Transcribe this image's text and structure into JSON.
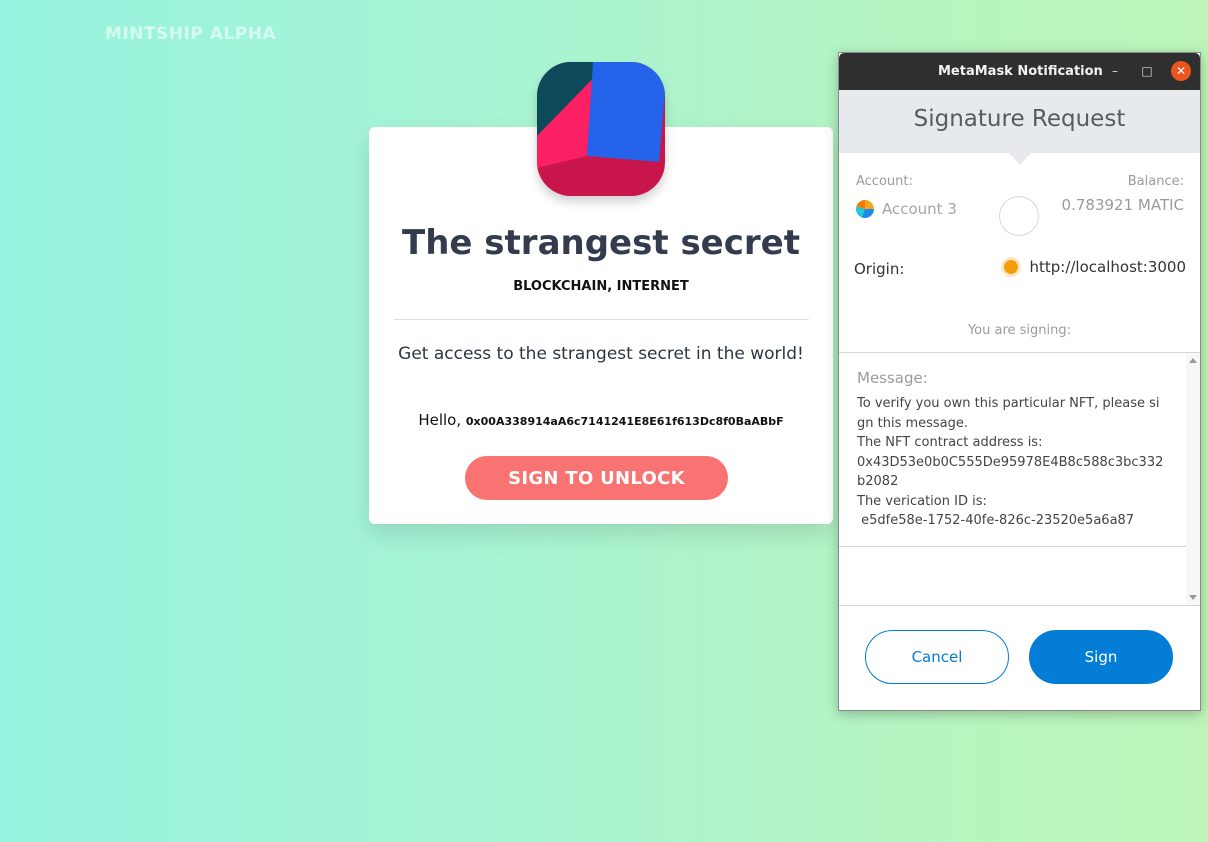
{
  "page": {
    "brand": "MINTSHIP ALPHA"
  },
  "card": {
    "title": "The strangest secret",
    "tags": "BLOCKCHAIN, INTERNET",
    "description": "Get access to the strangest secret in the world!",
    "hello_prefix": "Hello,",
    "wallet_address": "0x00A338914aA6c7141241E8E61f613Dc8f0BaABbF",
    "unlock_button": "SIGN TO UNLOCK"
  },
  "metamask": {
    "window_title": "MetaMask Notification",
    "header_title": "Signature Request",
    "account_label": "Account:",
    "account_name": "Account 3",
    "balance_label": "Balance:",
    "balance_value": "0.783921 MATIC",
    "origin_label": "Origin:",
    "origin_url": "http://localhost:3000",
    "signing_text": "You are signing:",
    "message_label": "Message:",
    "message_body": "To verify you own this particular NFT, please sign this message.\nThe NFT contract address is:\n0x43D53e0b0C555De95978E4B8c588c3bc332b2082\nThe verication ID is:\n e5dfe58e-1752-40fe-826c-23520e5a6a87",
    "cancel_button": "Cancel",
    "sign_button": "Sign"
  },
  "colors": {
    "accent_button": "#f87371",
    "metamask_blue": "#037dd6"
  },
  "icons": [
    "app-logo-icon",
    "account-avatar-icon",
    "origin-site-icon",
    "minimize-icon",
    "maximize-icon",
    "close-icon"
  ]
}
